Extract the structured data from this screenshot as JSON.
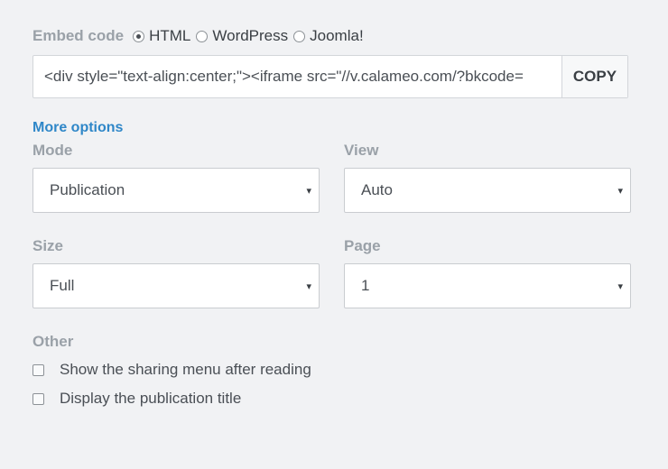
{
  "embed": {
    "label": "Embed code",
    "options": [
      "HTML",
      "WordPress",
      "Joomla!"
    ],
    "selected": "HTML",
    "code": "<div style=\"text-align:center;\"><iframe src=\"//v.calameo.com/?bkcode=",
    "copy_label": "COPY"
  },
  "more_options_label": "More options",
  "mode": {
    "label": "Mode",
    "value": "Publication"
  },
  "view": {
    "label": "View",
    "value": "Auto"
  },
  "size": {
    "label": "Size",
    "value": "Full"
  },
  "page": {
    "label": "Page",
    "value": "1"
  },
  "other": {
    "label": "Other",
    "checkboxes": [
      {
        "label": "Show the sharing menu after reading",
        "checked": false
      },
      {
        "label": "Display the publication title",
        "checked": false
      }
    ]
  },
  "icons": {
    "caret": "▾"
  }
}
